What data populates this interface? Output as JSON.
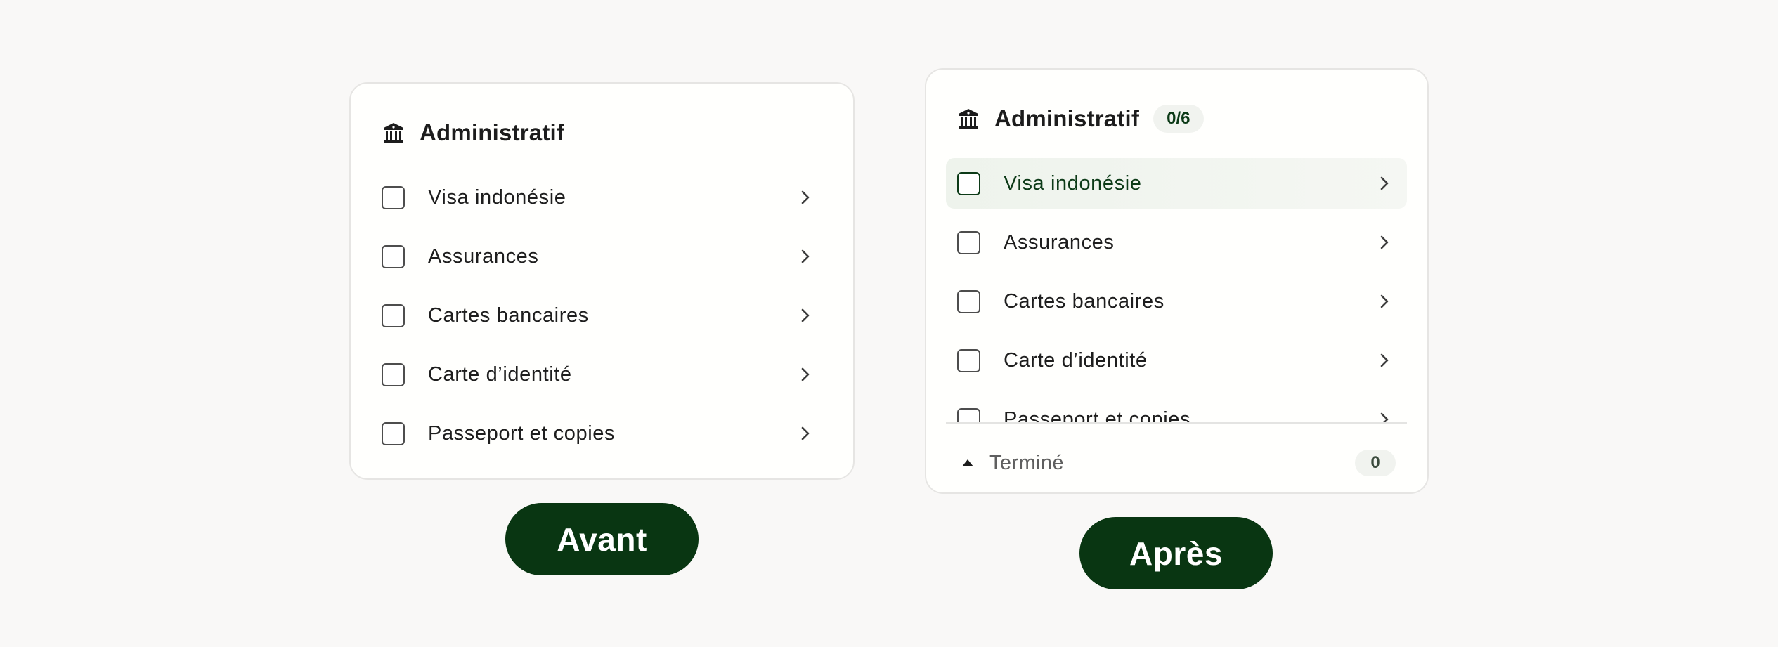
{
  "before": {
    "title": "Administratif",
    "icon": "bank-icon",
    "items": [
      {
        "label": "Visa indonésie"
      },
      {
        "label": "Assurances"
      },
      {
        "label": "Cartes bancaires"
      },
      {
        "label": "Carte d’identité"
      },
      {
        "label": "Passeport et copies"
      }
    ],
    "caption": "Avant"
  },
  "after": {
    "title": "Administratif",
    "icon": "bank-icon",
    "progress": "0/6",
    "items": [
      {
        "label": "Visa indonésie",
        "active": true
      },
      {
        "label": "Assurances"
      },
      {
        "label": "Cartes bancaires"
      },
      {
        "label": "Carte d’identité"
      },
      {
        "label": "Passeport et copies"
      }
    ],
    "footer": {
      "label": "Terminé",
      "count": "0"
    },
    "caption": "Après"
  },
  "colors": {
    "accent": "#093612",
    "background": "#f9f8f7",
    "card": "#fffffd",
    "pill": "#f1f3ef"
  }
}
